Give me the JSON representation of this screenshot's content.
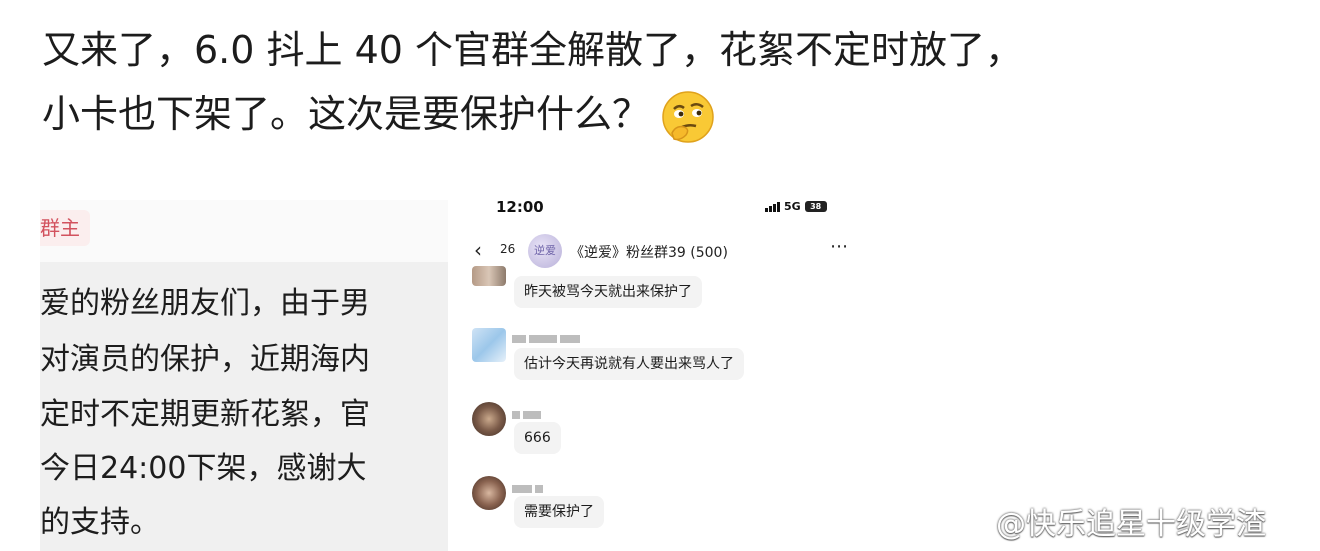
{
  "post": {
    "line1": "又来了，6.0 抖上 40 个官群全解散了，花絮不定时放了，",
    "line2": "小卡也下架了。这次是要保护什么？",
    "emoji": "thinking-face-icon"
  },
  "left_screenshot": {
    "owner_tag": "群主",
    "notice_lines": [
      "爱的粉丝朋友们，由于男",
      "对演员的保护，近期海内",
      "定时不定期更新花絮，官",
      "今日24:00下架，感谢大",
      "的支持。"
    ]
  },
  "right_screenshot": {
    "status": {
      "time": "12:00",
      "network": "5G",
      "battery": "38"
    },
    "header": {
      "back_count": "26",
      "avatar_text": "逆爱",
      "group_name": "《逆爱》粉丝群39 (500)"
    },
    "messages": [
      {
        "text": "昨天被骂今天就出来保护了"
      },
      {
        "text": "估计今天再说就有人要出来骂人了"
      },
      {
        "text": "666"
      },
      {
        "text": "需要保护了"
      }
    ]
  },
  "watermark": {
    "text": "@快乐追星十级学渣",
    "logo": "weibo-logo-icon"
  }
}
